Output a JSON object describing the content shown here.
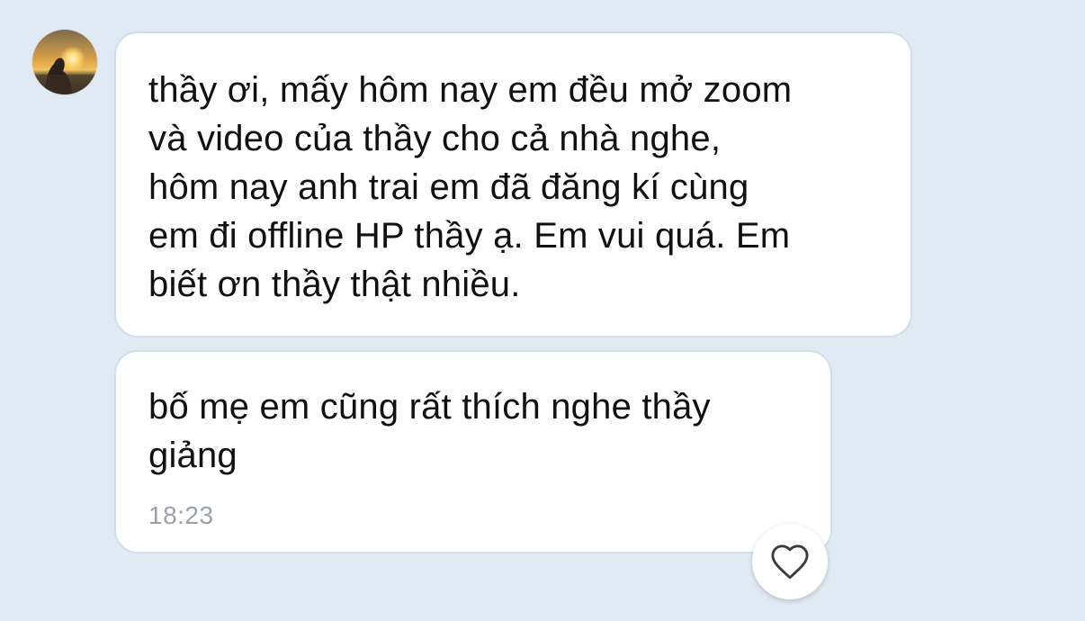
{
  "sender": {
    "avatar_icon": "avatar-sunset-photo"
  },
  "messages": [
    {
      "text": "thầy ơi, mấy hôm nay em đều mở zoom\nvà video của thầy cho cả nhà nghe,\nhôm nay anh trai em đã đăng kí cùng\nem đi offline HP thầy ạ. Em vui quá. Em\nbiết ơn thầy thật nhiều."
    },
    {
      "text": "bố mẹ em cũng rất thích nghe thầy\ngiảng",
      "time": "18:23"
    }
  ],
  "reaction": {
    "icon": "heart-outline-icon"
  },
  "colors": {
    "background": "#e1e9f3",
    "bubble": "#ffffff",
    "timestamp": "#9aa1a9"
  }
}
